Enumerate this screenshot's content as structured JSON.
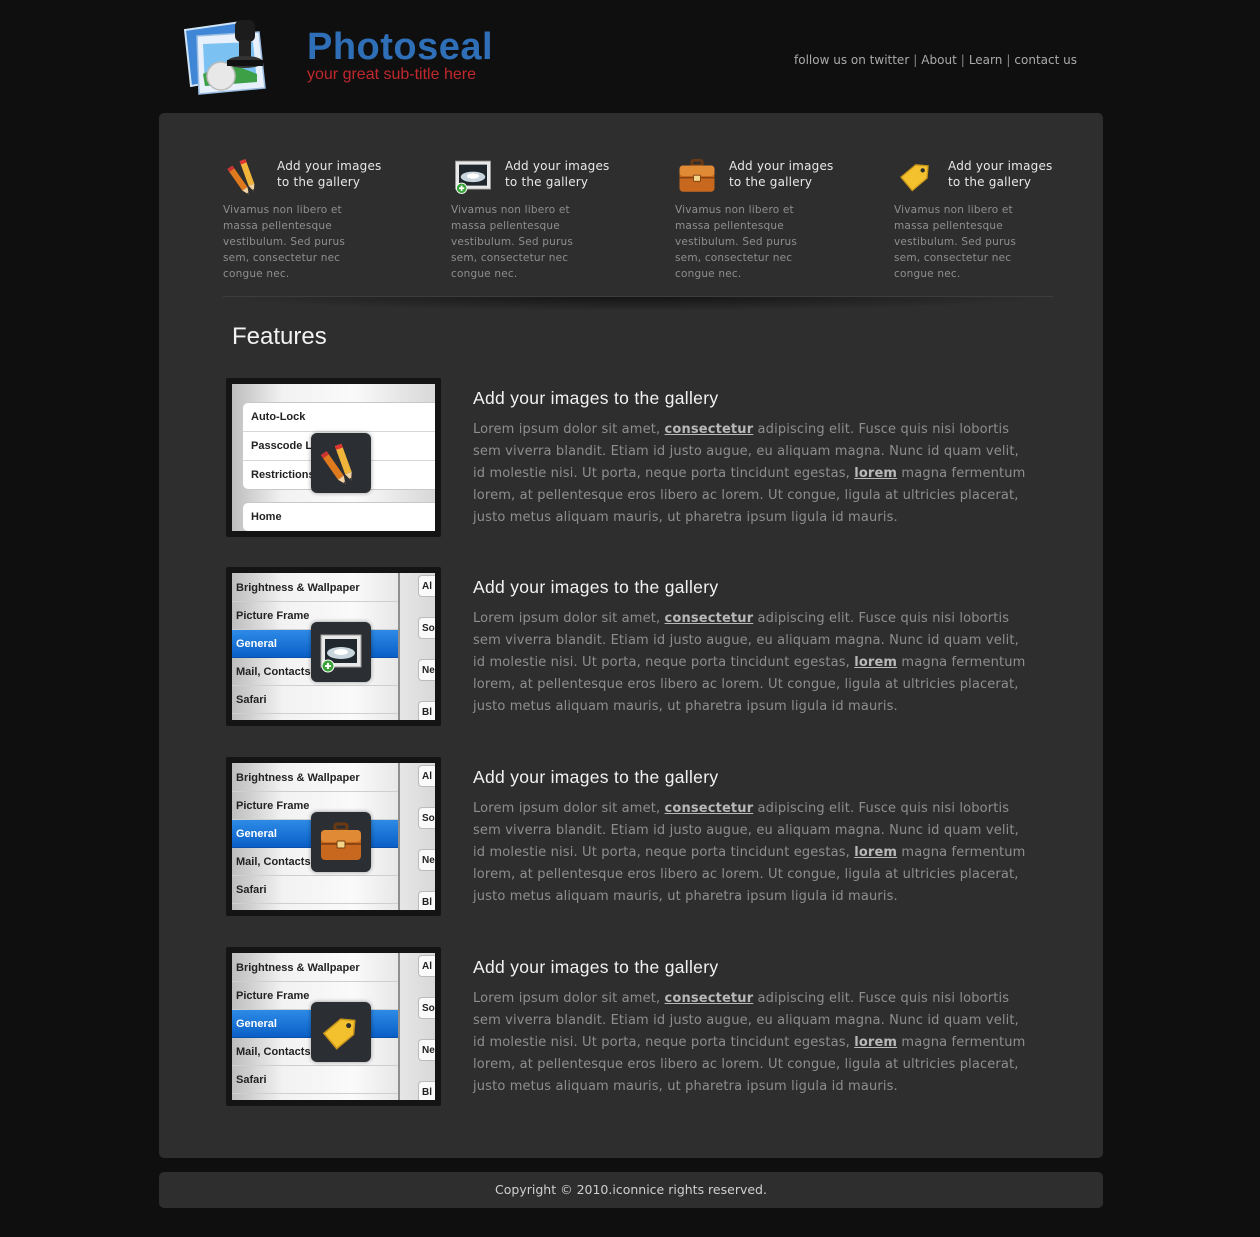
{
  "header": {
    "brand_title": "Photoseal",
    "brand_subtitle": "your great sub-title here",
    "nav": [
      {
        "label": "follow us on twitter"
      },
      {
        "label": "About"
      },
      {
        "label": "Learn"
      },
      {
        "label": "contact us"
      }
    ],
    "separator": "|"
  },
  "promos": [
    {
      "icon": "pencils-icon",
      "title": "Add your images to the gallery",
      "text": "Vivamus non libero et massa pellentesque vestibulum. Sed purus sem, consectetur nec congue nec."
    },
    {
      "icon": "image-add-icon",
      "title": "Add your images to the gallery",
      "text": "Vivamus non libero et massa pellentesque vestibulum. Sed purus sem, consectetur nec congue nec."
    },
    {
      "icon": "briefcase-icon",
      "title": "Add your images to the gallery",
      "text": "Vivamus non libero et massa pellentesque vestibulum. Sed purus sem, consectetur nec congue nec."
    },
    {
      "icon": "tag-icon",
      "title": "Add your images to the gallery",
      "text": "Vivamus non libero et massa pellentesque vestibulum. Sed purus sem, consectetur nec congue nec."
    }
  ],
  "features_heading": "Features",
  "feature_text": {
    "part1": "Lorem ipsum dolor sit amet, ",
    "link1": "consectetur",
    "part2": " adipiscing elit. Fusce quis nisi lobortis sem viverra blandit. Etiam id justo augue, eu aliquam magna. Nunc id quam velit, id molestie nisi. Ut porta, neque porta tincidunt egestas, ",
    "link2": "lorem",
    "part3": " magna fermentum lorem, at pellentesque eros libero ac lorem. Ut congue, ligula at ultricies placerat, justo metus aliquam mauris, ut pharetra ipsum ligula id mauris."
  },
  "features": [
    {
      "title": "Add your images to the gallery",
      "icon": "pencils-icon",
      "screen": {
        "type": "plain",
        "group1": [
          "Auto-Lock",
          "Passcode Lock",
          "Restrictions"
        ],
        "group2": [
          "Home"
        ]
      }
    },
    {
      "title": "Add your images to the gallery",
      "icon": "image-add-icon",
      "screen": {
        "type": "list",
        "rows": [
          "Brightness & Wallpaper",
          "Picture Frame",
          "General",
          "Mail, Contacts, Calendars",
          "Safari"
        ],
        "selected": "General",
        "right_buttons": [
          "Al",
          "So",
          "Ne",
          "Bl"
        ]
      }
    },
    {
      "title": "Add your images to the gallery",
      "icon": "briefcase-icon",
      "screen": {
        "type": "list",
        "rows": [
          "Brightness & Wallpaper",
          "Picture Frame",
          "General",
          "Mail, Contacts, Calendars",
          "Safari"
        ],
        "selected": "General",
        "right_buttons": [
          "Al",
          "So",
          "Ne",
          "Bl"
        ]
      }
    },
    {
      "title": "Add your images to the gallery",
      "icon": "tag-icon",
      "screen": {
        "type": "list",
        "rows": [
          "Brightness & Wallpaper",
          "Picture Frame",
          "General",
          "Mail, Contacts, Calendars",
          "Safari"
        ],
        "selected": "General",
        "right_buttons": [
          "Al",
          "So",
          "Ne",
          "Bl"
        ]
      }
    }
  ],
  "footer": {
    "text": "Copyright © 2010.iconnice rights reserved."
  },
  "colors": {
    "brand_blue": "#2f6fb8",
    "brand_red": "#c0282d",
    "panel": "#2e2e2e",
    "background": "#0f0f0f",
    "selection_blue": "#1a75d9"
  }
}
